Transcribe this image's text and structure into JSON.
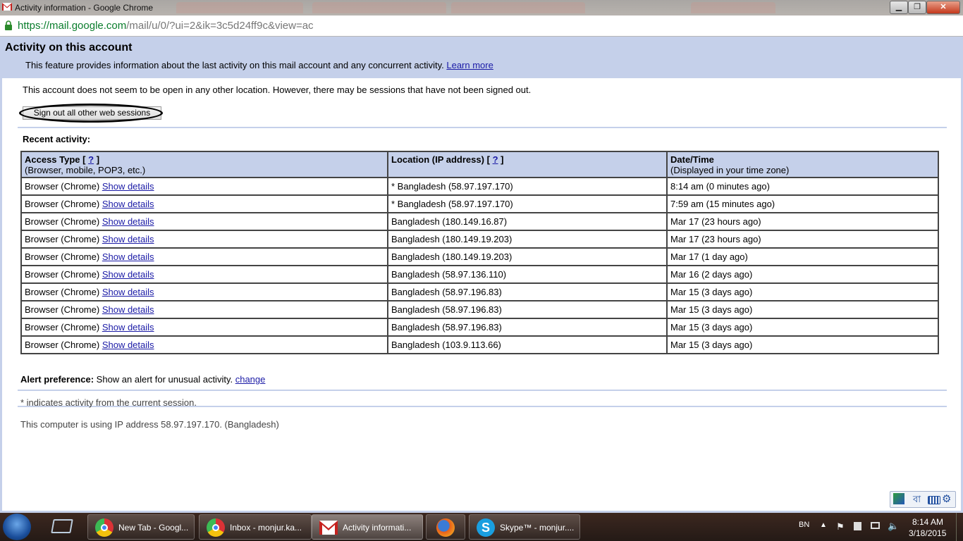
{
  "window": {
    "title": "Activity information - Google Chrome",
    "min_symbol": "▁",
    "max_symbol": "❐",
    "close_symbol": "✕"
  },
  "address_bar": {
    "scheme": "https://",
    "host": "mail.google.com",
    "path": "/mail/u/0/?ui=2&ik=3c5d24ff9c&view=ac"
  },
  "header": {
    "title": "Activity on this account",
    "description": "This feature provides information about the last activity on this mail account and any concurrent activity.",
    "learn_more": "Learn more"
  },
  "status_text": "This account does not seem to be open in any other location. However, there may be sessions that have not been signed out.",
  "signout_button": "Sign out all other web sessions",
  "recent_label": "Recent activity:",
  "table": {
    "headers": [
      {
        "title": "Access Type",
        "help": "?",
        "sub": "(Browser, mobile, POP3, etc.)"
      },
      {
        "title": "Location (IP address)",
        "help": "?",
        "sub": ""
      },
      {
        "title": "Date/Time",
        "help": "",
        "sub": "(Displayed in your time zone)"
      }
    ],
    "show_details": "Show details",
    "rows": [
      {
        "access": "Browser (Chrome)",
        "location": "* Bangladesh (58.97.197.170)",
        "datetime": "8:14 am (0 minutes ago)"
      },
      {
        "access": "Browser (Chrome)",
        "location": "* Bangladesh (58.97.197.170)",
        "datetime": "7:59 am (15 minutes ago)"
      },
      {
        "access": "Browser (Chrome)",
        "location": "Bangladesh (180.149.16.87)",
        "datetime": "Mar 17 (23 hours ago)"
      },
      {
        "access": "Browser (Chrome)",
        "location": "Bangladesh (180.149.19.203)",
        "datetime": "Mar 17 (23 hours ago)"
      },
      {
        "access": "Browser (Chrome)",
        "location": "Bangladesh (180.149.19.203)",
        "datetime": "Mar 17 (1 day ago)"
      },
      {
        "access": "Browser (Chrome)",
        "location": "Bangladesh (58.97.136.110)",
        "datetime": "Mar 16 (2 days ago)"
      },
      {
        "access": "Browser (Chrome)",
        "location": "Bangladesh (58.97.196.83)",
        "datetime": "Mar 15 (3 days ago)"
      },
      {
        "access": "Browser (Chrome)",
        "location": "Bangladesh (58.97.196.83)",
        "datetime": "Mar 15 (3 days ago)"
      },
      {
        "access": "Browser (Chrome)",
        "location": "Bangladesh (58.97.196.83)",
        "datetime": "Mar 15 (3 days ago)"
      },
      {
        "access": "Browser (Chrome)",
        "location": "Bangladesh (103.9.113.66)",
        "datetime": "Mar 15 (3 days ago)"
      }
    ]
  },
  "alert": {
    "label": "Alert preference:",
    "text": "Show an alert for unusual activity.",
    "change": "change"
  },
  "current_note": "* indicates activity from the current session.",
  "ip_note": "This computer is using IP address 58.97.197.170. (Bangladesh)",
  "ime_bar": {
    "lang_glyph": "বা",
    "keyboard_icon": "keyboard-icon",
    "settings_icon": "gear-icon"
  },
  "taskbar": {
    "items": [
      {
        "label": "New Tab - Googl...",
        "icon": "chrome-icon"
      },
      {
        "label": "Inbox - monjur.ka...",
        "icon": "chrome-icon"
      },
      {
        "label": "Activity informati...",
        "icon": "gmail-icon",
        "active": true
      },
      {
        "label": "",
        "icon": "firefox-icon"
      },
      {
        "label": "Skype™ - monjur....",
        "icon": "skype-icon"
      }
    ],
    "language": "BN",
    "time": "8:14 AM",
    "date": "3/18/2015"
  },
  "colors": {
    "header_bg": "#c5d0ea",
    "link": "#1a1aa6",
    "url_host": "#0a7d2c"
  }
}
